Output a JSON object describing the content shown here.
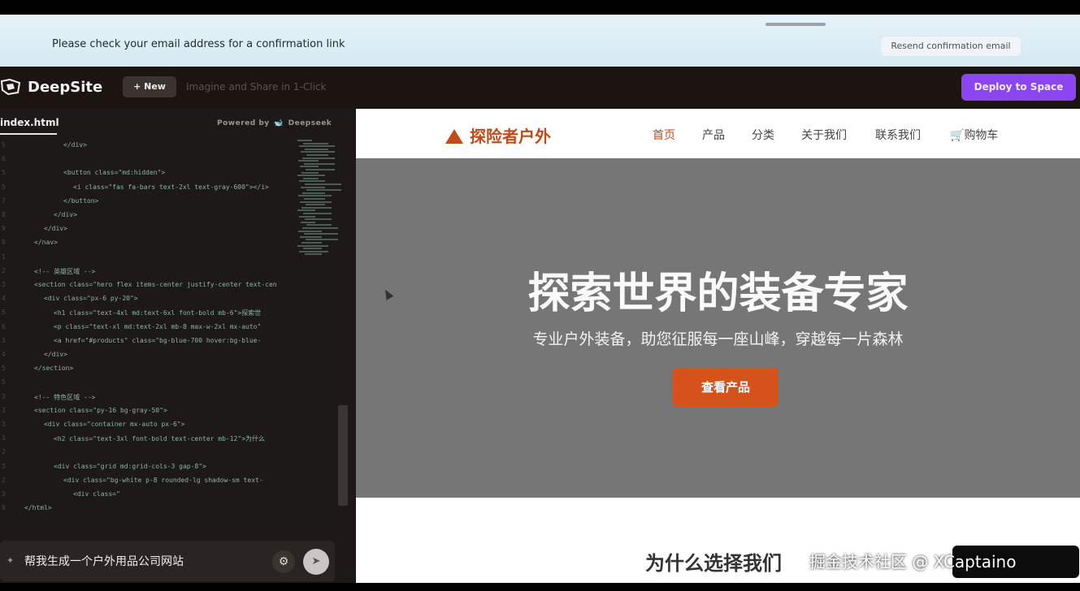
{
  "banner": {
    "message": "Please check your email address for a confirmation link",
    "resend_label": "Resend confirmation email"
  },
  "header": {
    "app_name": "DeepSite",
    "new_label": "+ New",
    "tagline": "Imagine and Share in 1-Click",
    "deploy_label": "Deploy to Space"
  },
  "editor": {
    "file_tab": "index.html",
    "powered_prefix": "Powered by",
    "powered_brand": "Deepseek",
    "lines": [
      {
        "n": "5",
        "indent": 78,
        "text": "</div>"
      },
      {
        "n": "6",
        "indent": 0,
        "text": ""
      },
      {
        "n": "5",
        "indent": 78,
        "text": "<button class=\"md:hidden\">"
      },
      {
        "n": "5",
        "indent": 90,
        "text": "<i class=\"fas fa-bars text-2xl text-gray-600\"></i>"
      },
      {
        "n": "7",
        "indent": 78,
        "text": "</button>"
      },
      {
        "n": "8",
        "indent": 66,
        "text": "</div>"
      },
      {
        "n": "9",
        "indent": 54,
        "text": "</div>"
      },
      {
        "n": "0",
        "indent": 42,
        "text": "</nav>"
      },
      {
        "n": "1",
        "indent": 0,
        "text": ""
      },
      {
        "n": "2",
        "indent": 42,
        "text": "<!-- 英雄区域 -->"
      },
      {
        "n": "3",
        "indent": 42,
        "text": "<section class=\"hero flex items-center justify-center text-cen"
      },
      {
        "n": "4",
        "indent": 54,
        "text": "<div class=\"px-6 py-20\">"
      },
      {
        "n": "5",
        "indent": 66,
        "text": "<h1 class=\"text-4xl md:text-6xl font-bold mb-6\">探索世"
      },
      {
        "n": "6",
        "indent": 66,
        "text": "<p class=\"text-xl md:text-2xl mb-8 max-w-2xl mx-auto\""
      },
      {
        "n": "3",
        "indent": 66,
        "text": "<a href=\"#products\" class=\"bg-blue-700 hover:bg-blue-"
      },
      {
        "n": "4",
        "indent": 54,
        "text": "</div>"
      },
      {
        "n": "5",
        "indent": 42,
        "text": "</section>"
      },
      {
        "n": "5",
        "indent": 0,
        "text": ""
      },
      {
        "n": "3",
        "indent": 42,
        "text": "<!-- 特色区域 -->"
      },
      {
        "n": "3",
        "indent": 42,
        "text": "<section class=\"py-16 bg-gray-50\">"
      },
      {
        "n": "3",
        "indent": 54,
        "text": "<div class=\"container mx-auto px-6\">"
      },
      {
        "n": "3",
        "indent": 66,
        "text": "<h2 class=\"text-3xl font-bold text-center mb-12\">为什么"
      },
      {
        "n": "2",
        "indent": 0,
        "text": ""
      },
      {
        "n": "3",
        "indent": 66,
        "text": "<div class=\"grid md:grid-cols-3 gap-8\">"
      },
      {
        "n": "2",
        "indent": 78,
        "text": "<div class=\"bg-white p-8 rounded-lg shadow-sm text-"
      },
      {
        "n": "3",
        "indent": 90,
        "text": "<div class=\""
      },
      {
        "n": "9",
        "indent": 30,
        "text": "</html>"
      }
    ]
  },
  "prompt": {
    "text": "帮我生成一个户外用品公司网站",
    "settings_icon": "gear-icon",
    "send_icon": "send-icon"
  },
  "preview": {
    "brand": "探险者户外",
    "nav": [
      "首页",
      "产品",
      "分类",
      "关于我们",
      "联系我们",
      "购物车"
    ],
    "hero_title": "探索世界的装备专家",
    "hero_subtitle": "专业户外装备，助您征服每一座山峰，穿越每一片森林",
    "hero_button": "查看产品",
    "section_title": "为什么选择我们"
  },
  "watermark": "掘金技术社区 @ XCaptaino",
  "colors": {
    "brand_orange": "#c24a18",
    "deploy_purple": "#8b46f2",
    "hero_gray": "#767676"
  }
}
